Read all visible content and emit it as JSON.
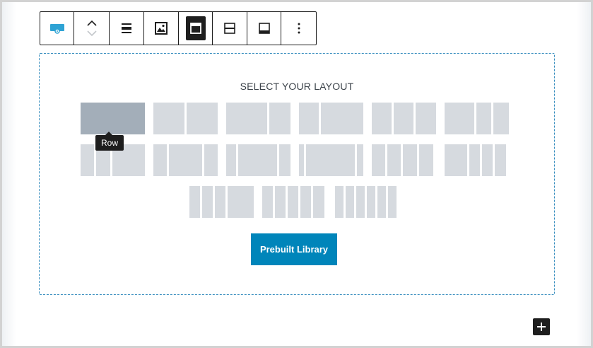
{
  "layout_selector": {
    "title": "SELECT YOUR LAYOUT",
    "tooltip": "Row",
    "prebuilt_label": "Prebuilt Library"
  },
  "toolbar": {
    "buttons": [
      {
        "name": "block-type-icon"
      },
      {
        "name": "move-up-down-icon"
      },
      {
        "name": "align-icon"
      },
      {
        "name": "image-icon"
      },
      {
        "name": "align-top-icon"
      },
      {
        "name": "align-middle-icon"
      },
      {
        "name": "align-bottom-icon"
      },
      {
        "name": "more-options-icon"
      }
    ]
  },
  "colors": {
    "accent": "#0085ba",
    "layout_fill": "#d6dadf",
    "layout_hover": "#a3aeb9",
    "dark": "#1e1e1e"
  }
}
